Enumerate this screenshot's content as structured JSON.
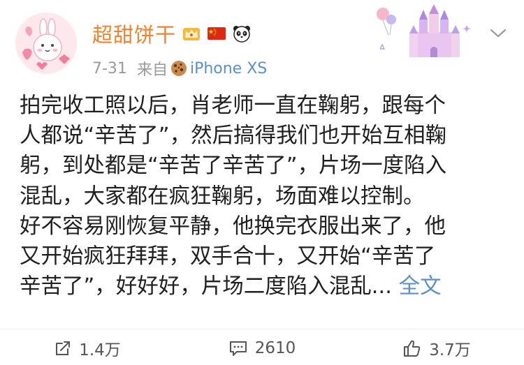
{
  "post": {
    "username": "超甜饼干",
    "date": "7-31",
    "source_prefix": "来自",
    "source": "iPhone XS",
    "content_lines": [
      "拍完收工照以后，肖老师一直在鞠躬，跟每个",
      "人都说“辛苦了”，然后搞得我们也开始互相鞠",
      "躬，到处都是“辛苦了辛苦了”，片场一度陷入",
      "混乱，大家都在疯狂鞠躬，场面难以控制。",
      "好不容易刚恢复平静，他换完衣服出来了，他",
      "又开始疯狂拜拜，双手合十，又开始“辛苦了",
      "辛苦了”，好好好，片场二度陷入混乱..."
    ],
    "more_label": "全文"
  },
  "actions": {
    "repost_count": "1.4万",
    "comment_count": "2610",
    "like_count": "3.7万"
  },
  "icons": {
    "badges": [
      "crown-icon",
      "china-flag-icon",
      "panda-icon"
    ],
    "source_icon": "cookie-icon",
    "menu": "chevron-down-icon",
    "repost": "repost-icon",
    "comment": "comment-icon",
    "like": "thumbs-up-icon"
  },
  "colors": {
    "username": "#f5822a",
    "link": "#5b8fc8",
    "meta": "#9a9a9a",
    "text": "#1f1f1f"
  }
}
